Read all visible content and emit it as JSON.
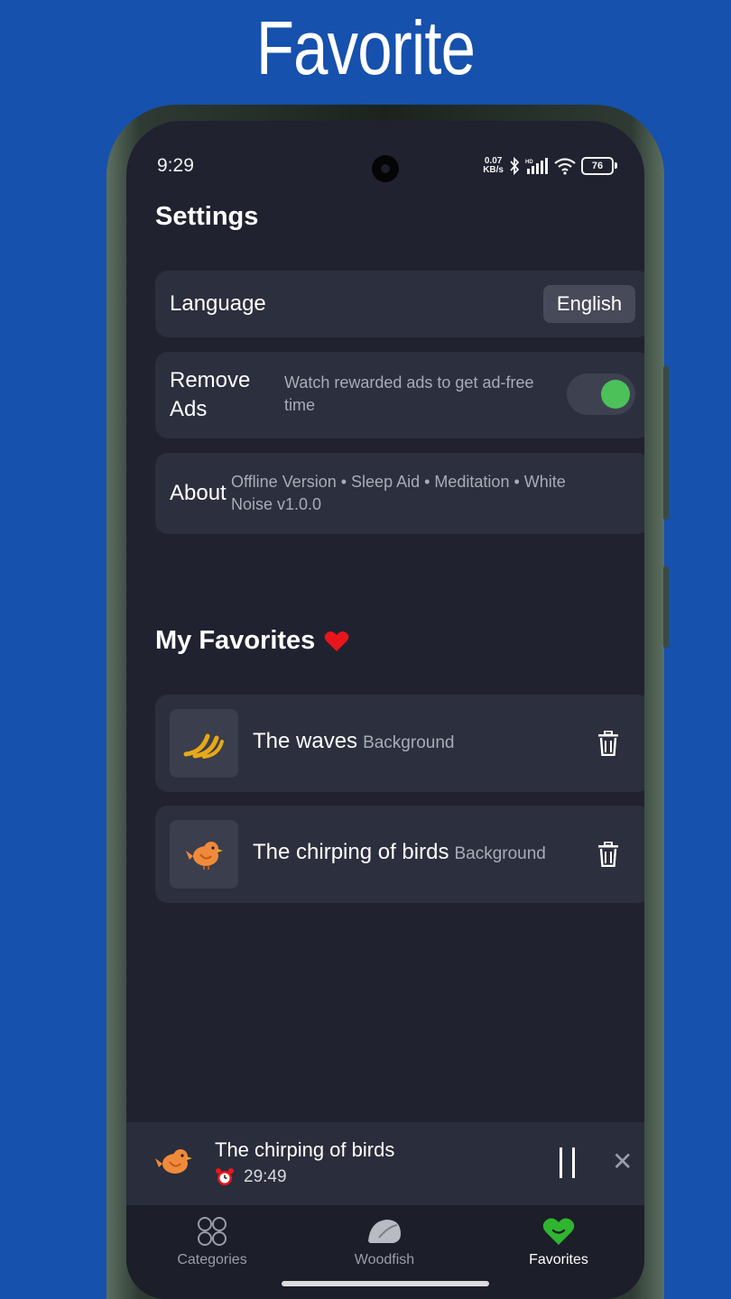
{
  "hero_title": "Favorite",
  "status_bar": {
    "time": "9:29",
    "net_speed_value": "0.07",
    "net_speed_unit": "KB/s",
    "battery": "76",
    "icons": [
      "bluetooth-icon",
      "signal-icon",
      "wifi-icon",
      "battery-icon"
    ]
  },
  "settings": {
    "title": "Settings",
    "language": {
      "label": "Language",
      "value": "English"
    },
    "remove_ads": {
      "label_line1": "Remove",
      "label_line2": "Ads",
      "desc_line1": "Watch rewarded ads to get ad-free",
      "desc_line2": "time",
      "enabled": true
    },
    "about": {
      "label": "About",
      "desc_line1": "Offline Version • Sleep Aid • Meditation • White",
      "desc_line2": "Noise v1.0.0"
    }
  },
  "favorites": {
    "title": "My Favorites",
    "items": [
      {
        "name": "The waves",
        "tag": "Background",
        "icon": "waves-icon"
      },
      {
        "name": "The chirping of birds",
        "tag": "Background",
        "icon": "bird-icon"
      }
    ]
  },
  "player": {
    "title": "The chirping of birds",
    "timer": "29:49",
    "icon": "bird-icon"
  },
  "nav": {
    "items": [
      {
        "label": "Categories",
        "icon": "categories-icon",
        "active": false
      },
      {
        "label": "Woodfish",
        "icon": "woodfish-icon",
        "active": false
      },
      {
        "label": "Favorites",
        "icon": "heart-icon",
        "active": true
      }
    ]
  },
  "colors": {
    "page_bg": "#1551ad",
    "screen_bg": "#202230",
    "card_bg": "#2c2f3d",
    "toggle_on": "#4cc15a",
    "heart": "#e8161b",
    "active_tab_icon": "#2fb52f"
  }
}
